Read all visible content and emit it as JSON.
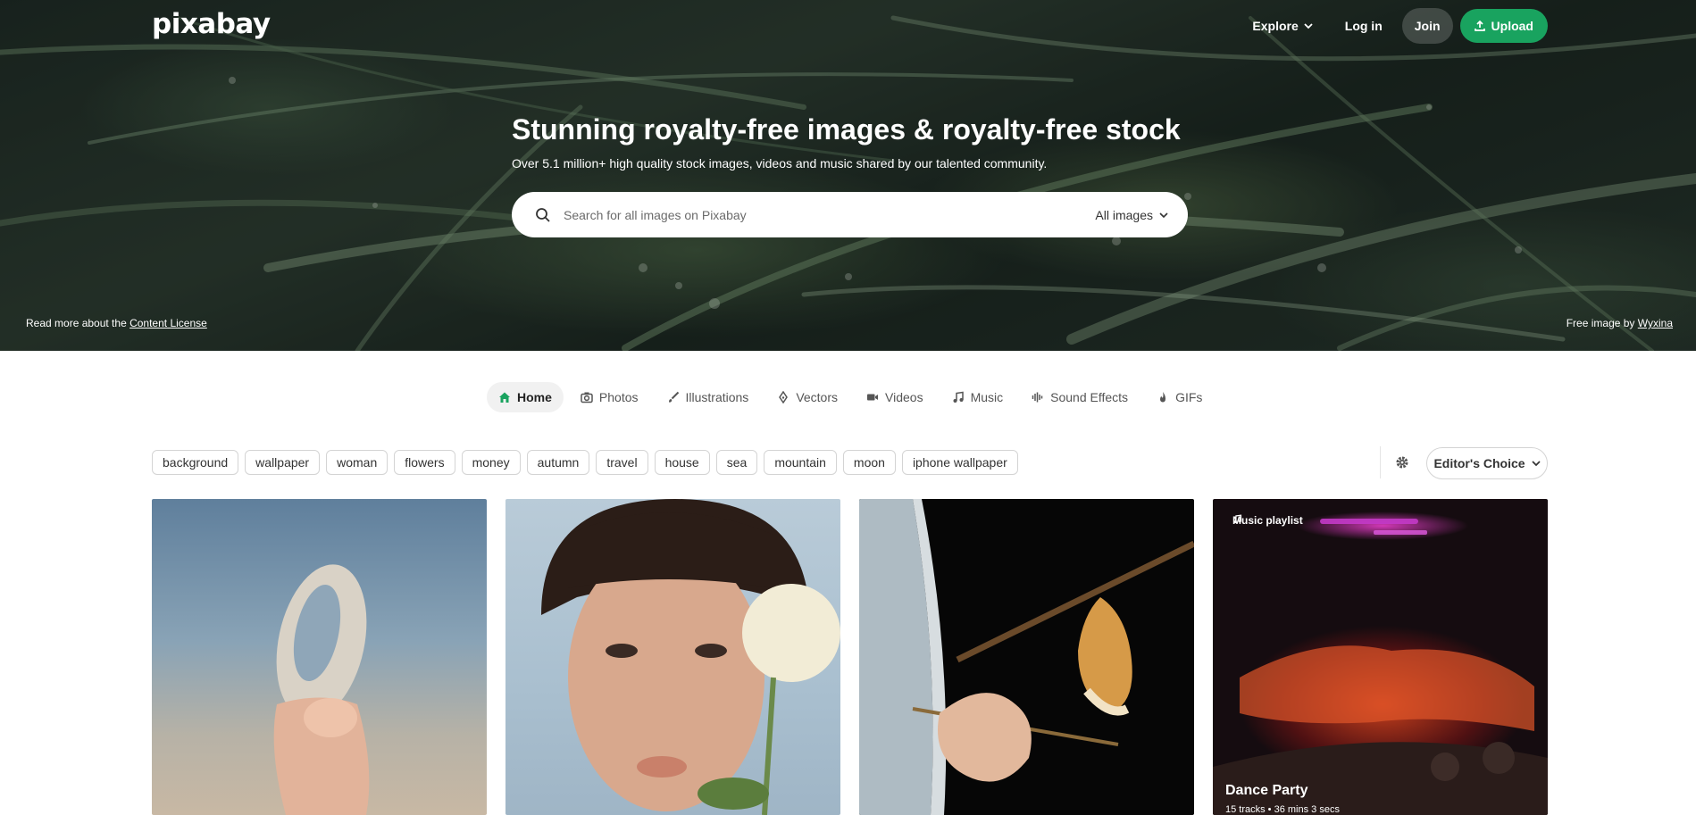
{
  "header": {
    "logo": "pixabay",
    "explore": "Explore",
    "login": "Log in",
    "join": "Join",
    "upload": "Upload"
  },
  "hero": {
    "title": "Stunning royalty-free images & royalty-free stock",
    "subtitle": "Over 5.1 million+ high quality stock images, videos and music shared by our talented community.",
    "search_placeholder": "Search for all images on Pixabay",
    "search_type": "All images",
    "license_prefix": "Read more about the ",
    "license_link": "Content License",
    "credit_prefix": "Free image by ",
    "credit_author": "Wyxina"
  },
  "tabs": [
    {
      "label": "Home",
      "icon": "home-icon"
    },
    {
      "label": "Photos",
      "icon": "camera-icon"
    },
    {
      "label": "Illustrations",
      "icon": "brush-icon"
    },
    {
      "label": "Vectors",
      "icon": "pen-nib-icon"
    },
    {
      "label": "Videos",
      "icon": "video-icon"
    },
    {
      "label": "Music",
      "icon": "music-icon"
    },
    {
      "label": "Sound Effects",
      "icon": "waveform-icon"
    },
    {
      "label": "GIFs",
      "icon": "flame-icon"
    }
  ],
  "tags": [
    "background",
    "wallpaper",
    "woman",
    "flowers",
    "money",
    "autumn",
    "travel",
    "house",
    "sea",
    "mountain",
    "moon",
    "iphone wallpaper"
  ],
  "sort": {
    "label": "Editor's Choice"
  },
  "playlist": {
    "badge": "Music playlist",
    "title": "Dance Party",
    "meta": "15 tracks  •  36 mins 3 secs"
  },
  "colors": {
    "accent": "#19a35f"
  }
}
